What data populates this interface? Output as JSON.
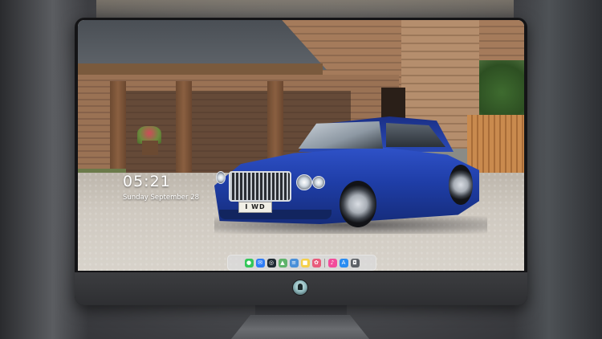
{
  "lock_screen": {
    "time": "05:21",
    "date": "Sunday September 28"
  },
  "wallpaper": {
    "plate_text": "I WD"
  },
  "dock": {
    "items": [
      {
        "name": "messages-icon",
        "color": "#34c759",
        "glyph": "●"
      },
      {
        "name": "mail-icon",
        "color": "#2f7df6",
        "glyph": "✉"
      },
      {
        "name": "safari-icon",
        "color": "#1f2a33",
        "glyph": "◎"
      },
      {
        "name": "maps-icon",
        "color": "#5fb36a",
        "glyph": "▲"
      },
      {
        "name": "notes-icon",
        "color": "#4a90d9",
        "glyph": "≡"
      },
      {
        "name": "reminders-icon",
        "color": "#f5d04a",
        "glyph": "■"
      },
      {
        "name": "photos-icon",
        "color": "#e95c7c",
        "glyph": "✿"
      },
      {
        "name": "music-icon",
        "color": "#f34d9b",
        "glyph": "♪"
      },
      {
        "name": "app-store-icon",
        "color": "#2a8cf2",
        "glyph": "A"
      },
      {
        "name": "camera-icon",
        "color": "#5d6166",
        "glyph": "◘"
      }
    ]
  },
  "colors": {
    "car_accent": "#2342b8",
    "bezel": "#141416"
  }
}
